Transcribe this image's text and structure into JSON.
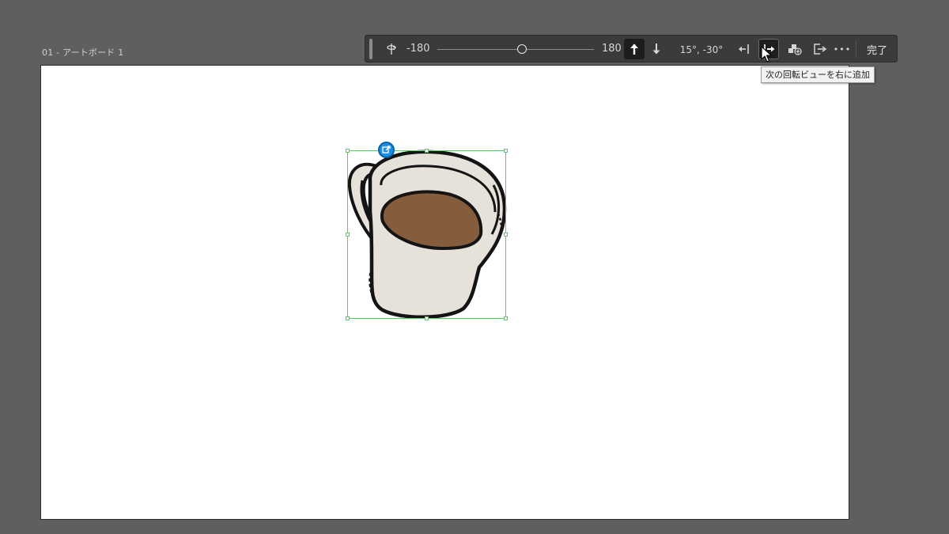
{
  "artboard": {
    "label": "01 - アートボード 1"
  },
  "toolbar": {
    "slider_min": "-180",
    "slider_max": "180",
    "slider_value_fraction": 0.54,
    "angle_readout": "15°, -30°",
    "done_label": "完了",
    "more_label": "•••"
  },
  "tooltip": {
    "text": "次の回転ビューを右に追加"
  },
  "colors": {
    "canvas_bg": "#5f5f5f",
    "toolbar_bg": "#3b3b3b",
    "selection": "#4cd45a",
    "rotate_badge": "#1a8fe3",
    "mug_body": "#e6e2da",
    "coffee": "#855c3c"
  },
  "icons": {
    "rotate_axis": "rotate-axis-icon",
    "arrow_up": "arrow-up-icon",
    "arrow_down": "arrow-down-icon",
    "add_left": "add-view-left-icon",
    "add_right": "add-view-right-icon",
    "add_object": "add-object-icon",
    "export": "export-icon",
    "rotate_badge": "rotate-edit-icon"
  }
}
